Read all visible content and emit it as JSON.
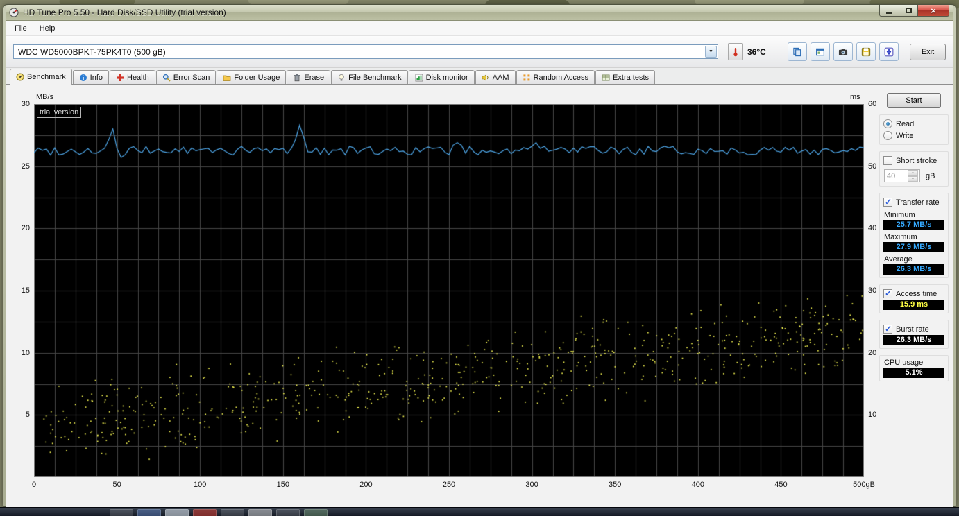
{
  "window": {
    "title": "HD Tune Pro 5.50 - Hard Disk/SSD Utility (trial version)"
  },
  "menu": {
    "items": [
      "File",
      "Help"
    ]
  },
  "toolbar": {
    "drive_select": "WDC WD5000BPKT-75PK4T0 (500 gB)",
    "temperature": "36°C",
    "buttons": [
      {
        "icon": "copy-text-icon"
      },
      {
        "icon": "copy-image-icon"
      },
      {
        "icon": "camera-icon"
      },
      {
        "icon": "save-icon"
      },
      {
        "icon": "download-icon"
      }
    ],
    "exit_label": "Exit"
  },
  "tabs": [
    {
      "label": "Benchmark",
      "icon": "benchmark-icon",
      "active": true
    },
    {
      "label": "Info",
      "icon": "info-icon"
    },
    {
      "label": "Health",
      "icon": "health-icon"
    },
    {
      "label": "Error Scan",
      "icon": "error-scan-icon"
    },
    {
      "label": "Folder Usage",
      "icon": "folder-usage-icon"
    },
    {
      "label": "Erase",
      "icon": "erase-icon"
    },
    {
      "label": "File Benchmark",
      "icon": "file-benchmark-icon"
    },
    {
      "label": "Disk monitor",
      "icon": "disk-monitor-icon"
    },
    {
      "label": "AAM",
      "icon": "aam-icon"
    },
    {
      "label": "Random Access",
      "icon": "random-access-icon"
    },
    {
      "label": "Extra tests",
      "icon": "extra-tests-icon"
    }
  ],
  "panel": {
    "start_label": "Start",
    "read_label": "Read",
    "write_label": "Write",
    "short_stroke_label": "Short stroke",
    "short_stroke_value": "40",
    "short_stroke_unit": "gB",
    "transfer_rate": {
      "label": "Transfer rate",
      "minimum_label": "Minimum",
      "minimum_value": "25.7 MB/s",
      "maximum_label": "Maximum",
      "maximum_value": "27.9 MB/s",
      "average_label": "Average",
      "average_value": "26.3 MB/s"
    },
    "access_time": {
      "label": "Access time",
      "value": "15.9 ms"
    },
    "burst_rate": {
      "label": "Burst rate",
      "value": "26.3 MB/s"
    },
    "cpu_usage": {
      "label": "CPU usage",
      "value": "5.1%"
    }
  },
  "chart": {
    "watermark": "trial version",
    "left_axis": {
      "unit": "MB/s",
      "min": 0,
      "max": 30,
      "ticks": [
        30,
        25,
        20,
        15,
        10,
        5
      ]
    },
    "right_axis": {
      "unit": "ms",
      "min": 0,
      "max": 60,
      "ticks": [
        60,
        50,
        40,
        30,
        20,
        10
      ]
    },
    "x_axis": {
      "min": 0,
      "max": 500,
      "tick_values": [
        0,
        50,
        100,
        150,
        200,
        250,
        300,
        350,
        400,
        450,
        500
      ],
      "tick_labels": [
        "0",
        "50",
        "100",
        "150",
        "200",
        "250",
        "300",
        "350",
        "400",
        "450",
        "500gB"
      ]
    },
    "colors": {
      "plot_bg": "#000000",
      "grid": "#474747",
      "border": "#8a8a8a",
      "transfer_line": "#4fa8ea",
      "access_dots": "#ffff55"
    }
  },
  "chart_data": {
    "type": "line+scatter",
    "x_range": [
      0,
      500
    ],
    "x_unit": "gB",
    "series": [
      {
        "name": "Transfer rate",
        "unit": "MB/s",
        "axis": "left",
        "baseline": 26.25,
        "noise": 0.35,
        "min": 25.7,
        "max": 27.9,
        "average": 26.3,
        "spikes": [
          {
            "x": 47,
            "y": 28.0
          },
          {
            "x": 52,
            "y": 25.7
          },
          {
            "x": 160,
            "y": 28.3
          },
          {
            "x": 255,
            "y": 26.9
          },
          {
            "x": 302,
            "y": 26.9
          }
        ]
      },
      {
        "name": "Access time",
        "unit": "ms",
        "axis": "right",
        "average": 15.9,
        "trend_start_ms": 8,
        "trend_end_ms": 24,
        "spread_ms": 5,
        "points_count": 680
      }
    ]
  }
}
